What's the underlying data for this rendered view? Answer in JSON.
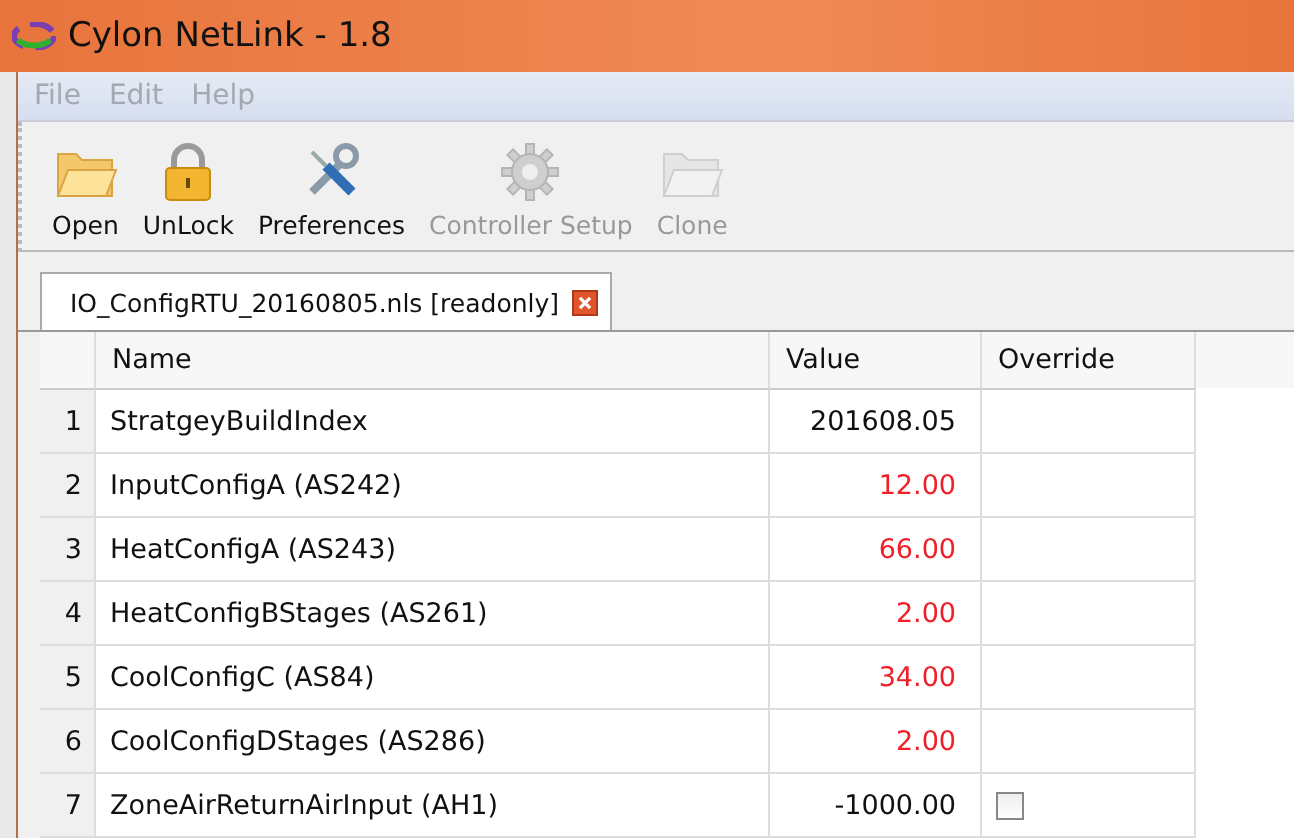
{
  "window": {
    "title": "Cylon NetLink - 1.8"
  },
  "menu": [
    {
      "label": "File",
      "disabled": true
    },
    {
      "label": "Edit",
      "disabled": true
    },
    {
      "label": "Help",
      "disabled": true
    }
  ],
  "toolbar": [
    {
      "label": "Open",
      "kind": "folder",
      "disabled": false
    },
    {
      "label": "UnLock",
      "kind": "lock",
      "disabled": false
    },
    {
      "label": "Preferences",
      "kind": "tools",
      "disabled": false
    },
    {
      "label": "Controller Setup",
      "kind": "gear",
      "disabled": true
    },
    {
      "label": "Clone",
      "kind": "folder",
      "disabled": true
    }
  ],
  "tabs": [
    {
      "label": "IO_ConfigRTU_20160805.nls [readonly]",
      "selected": true
    }
  ],
  "table": {
    "columns": [
      "Name",
      "Value",
      "Override"
    ],
    "rows": [
      {
        "index": "1",
        "name": "StratgeyBuildIndex",
        "value": "201608.05",
        "changed": false
      },
      {
        "index": "2",
        "name": "InputConfigA (AS242)",
        "value": "12.00",
        "changed": true
      },
      {
        "index": "3",
        "name": "HeatConfigA (AS243)",
        "value": "66.00",
        "changed": true
      },
      {
        "index": "4",
        "name": "HeatConfigBStages (AS261)",
        "value": "2.00",
        "changed": true
      },
      {
        "index": "5",
        "name": "CoolConfigC (AS84)",
        "value": "34.00",
        "changed": true
      },
      {
        "index": "6",
        "name": "CoolConfigDStages (AS286)",
        "value": "2.00",
        "changed": true
      },
      {
        "index": "7",
        "name": "ZoneAirReturnAirInput (AH1)",
        "value": "-1000.00",
        "changed": false,
        "override": {
          "checked": false
        }
      }
    ]
  }
}
